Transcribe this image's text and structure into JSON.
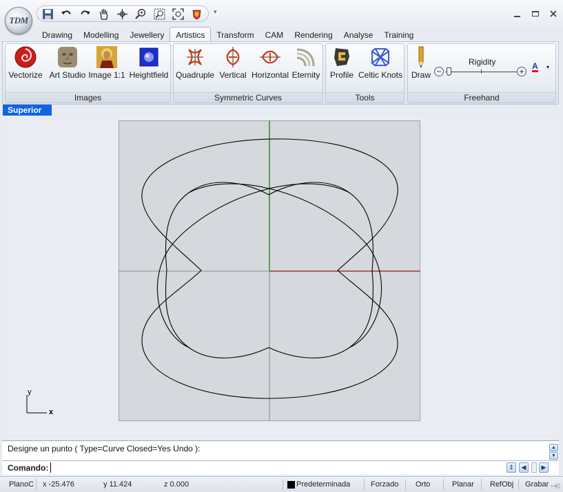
{
  "app": {
    "logo_text": "TDM"
  },
  "quick_access": {
    "items": [
      "save-icon",
      "undo-icon",
      "redo-icon",
      "pan-hand-icon",
      "rotate-view-icon",
      "zoom-icon",
      "zoom-window-icon",
      "zoom-extents-icon",
      "render-icon"
    ]
  },
  "tabs": [
    {
      "label": "Drawing"
    },
    {
      "label": "Modelling"
    },
    {
      "label": "Jewellery"
    },
    {
      "label": "Artistics",
      "active": true
    },
    {
      "label": "Transform"
    },
    {
      "label": "CAM"
    },
    {
      "label": "Rendering"
    },
    {
      "label": "Analyse"
    },
    {
      "label": "Training"
    }
  ],
  "ribbon": {
    "images": {
      "label": "Images",
      "buttons": {
        "vectorize": "Vectorize",
        "art_studio": "Art Studio",
        "image_1_1": "Image 1:1",
        "heightfield": "Heightfield"
      }
    },
    "symmetric_curves": {
      "label": "Symmetric Curves",
      "buttons": {
        "quadruple": "Quadruple",
        "vertical": "Vertical",
        "horizontal": "Horizontal",
        "eternity": "Eternity"
      }
    },
    "tools": {
      "label": "Tools",
      "buttons": {
        "profile": "Profile",
        "celtic_knots": "Celtic Knots"
      }
    },
    "freehand": {
      "label": "Freehand",
      "draw": "Draw",
      "rigidity_label": "Rigidity",
      "rigidity_value": 0.05,
      "font_color_glyph": "A"
    }
  },
  "viewport": {
    "name": "Superior",
    "axis_x_label": "x",
    "axis_y_label": "y",
    "colors": {
      "x_axis": "#9a3b32",
      "y_axis": "#2f8a35",
      "grid_bg": "#d5d8dc",
      "curve": "#000000"
    }
  },
  "command": {
    "history": "Designe un punto ( Type=Curve  Closed=Yes  Undo ):",
    "prompt_label": "Comando:",
    "input_value": ""
  },
  "status_bar": {
    "plane": "PlanoC",
    "x": "x -25.476",
    "y": "y 11.424",
    "z": "z 0.000",
    "layer": "Predeterminada",
    "snap": "Forzado",
    "ortho": "Orto",
    "planar": "Planar",
    "osnap": "RefObj",
    "record": "Grabar ..."
  }
}
